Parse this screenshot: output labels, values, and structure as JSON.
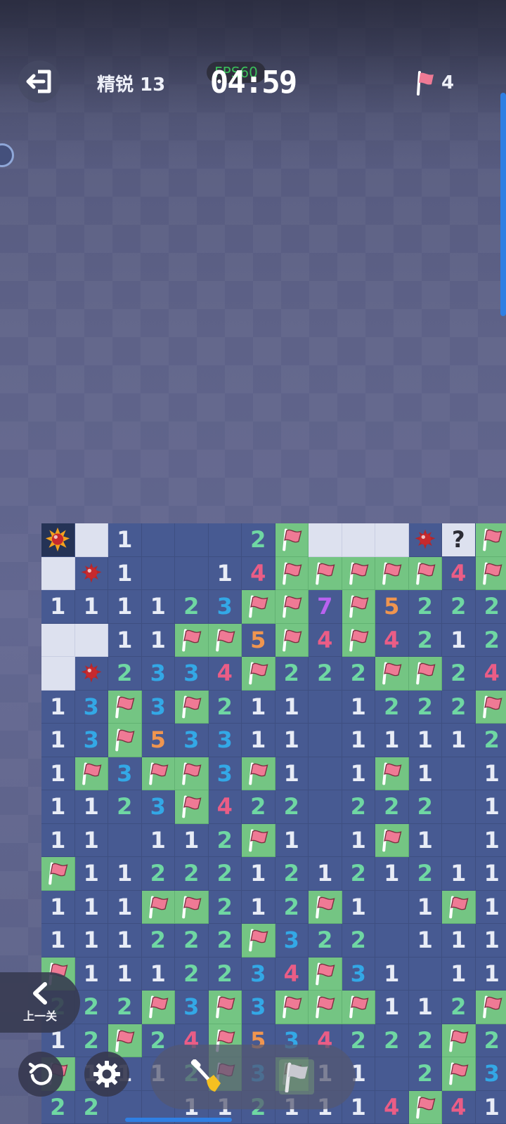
{
  "header": {
    "level": "精锐 13",
    "fps": "FPS60",
    "timer": "04:59",
    "flags_remaining": "4"
  },
  "controls": {
    "prev_level_label": "上一关"
  },
  "icons": [
    "exit-icon",
    "flag-icon",
    "chevron-left-icon",
    "restart-icon",
    "gear-icon",
    "shovel-icon",
    "flag-tool-icon",
    "mine-icon"
  ],
  "colors": {
    "tile_open": "#475a92",
    "tile_covered": "#dde1ef",
    "tile_flag": "#74c583",
    "num1": "#e8ecf6",
    "num2": "#6fd7a3",
    "num3": "#33a8e6",
    "num4": "#ea5d86",
    "num5": "#f0954f",
    "num7": "#b962f0",
    "accent": "#2f7fe3"
  },
  "board": {
    "legend": "F=flag, M=mine, X=exploded mine, #=covered, ?=question, 0=empty, digit=number",
    "rows": [
      [
        "X",
        "#",
        "1",
        "0",
        "0",
        "0",
        "2",
        "F",
        "#",
        "#",
        "#",
        "M",
        "?",
        "F"
      ],
      [
        "#",
        "M",
        "1",
        "0",
        "0",
        "1",
        "4",
        "F",
        "F",
        "F",
        "F",
        "F",
        "4",
        "F"
      ],
      [
        "1",
        "1",
        "1",
        "1",
        "2",
        "3",
        "F",
        "F",
        "7",
        "F",
        "5",
        "2",
        "2",
        "2"
      ],
      [
        "#",
        "#",
        "1",
        "1",
        "F",
        "F",
        "5",
        "F",
        "4",
        "F",
        "4",
        "2",
        "1",
        "2"
      ],
      [
        "#",
        "M",
        "2",
        "3",
        "3",
        "4",
        "F",
        "2",
        "2",
        "2",
        "F",
        "F",
        "2",
        "4"
      ],
      [
        "1",
        "3",
        "F",
        "3",
        "F",
        "2",
        "1",
        "1",
        "0",
        "1",
        "2",
        "2",
        "2",
        "F"
      ],
      [
        "1",
        "3",
        "F",
        "5",
        "3",
        "3",
        "1",
        "1",
        "0",
        "1",
        "1",
        "1",
        "1",
        "2"
      ],
      [
        "1",
        "F",
        "3",
        "F",
        "F",
        "3",
        "F",
        "1",
        "0",
        "1",
        "F",
        "1",
        "0",
        "1"
      ],
      [
        "1",
        "1",
        "2",
        "3",
        "F",
        "4",
        "2",
        "2",
        "0",
        "2",
        "2",
        "2",
        "0",
        "1"
      ],
      [
        "1",
        "1",
        "0",
        "1",
        "1",
        "2",
        "F",
        "1",
        "0",
        "1",
        "F",
        "1",
        "0",
        "1"
      ],
      [
        "F",
        "1",
        "1",
        "2",
        "2",
        "2",
        "1",
        "2",
        "1",
        "2",
        "1",
        "2",
        "1",
        "1"
      ],
      [
        "1",
        "1",
        "1",
        "F",
        "F",
        "2",
        "1",
        "2",
        "F",
        "1",
        "0",
        "1",
        "F",
        "1"
      ],
      [
        "1",
        "1",
        "1",
        "2",
        "2",
        "2",
        "F",
        "3",
        "2",
        "2",
        "0",
        "1",
        "1",
        "1"
      ],
      [
        "F",
        "1",
        "1",
        "1",
        "2",
        "2",
        "3",
        "4",
        "F",
        "3",
        "1",
        "0",
        "1",
        "1"
      ],
      [
        "2",
        "2",
        "2",
        "F",
        "3",
        "F",
        "3",
        "F",
        "F",
        "F",
        "1",
        "1",
        "2",
        "F"
      ],
      [
        "1",
        "2",
        "F",
        "2",
        "4",
        "F",
        "5",
        "3",
        "4",
        "2",
        "2",
        "2",
        "F",
        "2"
      ],
      [
        "F",
        "1",
        "1",
        "1",
        "2",
        "F",
        "3",
        "F",
        "1",
        "1",
        "0",
        "2",
        "F",
        "3"
      ],
      [
        "2",
        "2",
        "0",
        "0",
        "1",
        "1",
        "2",
        "1",
        "1",
        "1",
        "4",
        "F",
        "4",
        "1"
      ]
    ]
  }
}
